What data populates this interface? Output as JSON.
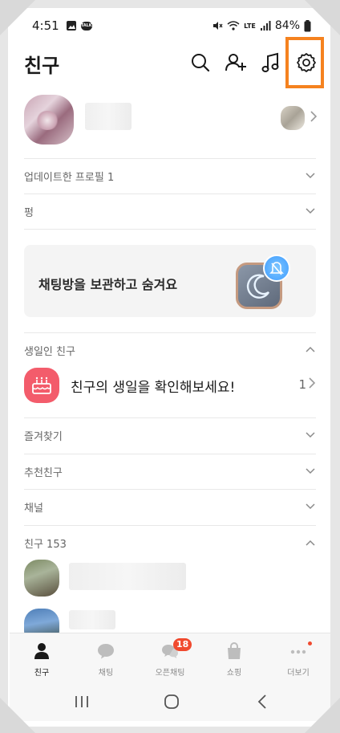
{
  "status_bar": {
    "time": "4:51",
    "talk_badge": "TALK",
    "battery": "84%",
    "network": "LTE"
  },
  "header": {
    "title": "친구"
  },
  "rows": {
    "updated_profiles": "업데이트한 프로필 1",
    "pung": "펑"
  },
  "banner": {
    "text": "채팅방을 보관하고 숨겨요"
  },
  "birthday_section": {
    "header": "생일인 친구",
    "message": "친구의 생일을 확인해보세요!",
    "count": "1"
  },
  "sections": {
    "favorites": "즐겨찾기",
    "recommended": "추천친구",
    "channels": "채널",
    "friends": "친구 153"
  },
  "tabs": [
    {
      "label": "친구",
      "icon": "person-icon"
    },
    {
      "label": "채팅",
      "icon": "chat-bubble-icon"
    },
    {
      "label": "오픈채팅",
      "icon": "open-chat-icon",
      "badge": "18"
    },
    {
      "label": "쇼핑",
      "icon": "shopping-bag-icon"
    },
    {
      "label": "더보기",
      "icon": "more-dots-icon"
    }
  ],
  "colors": {
    "highlight": "#f5821f",
    "badge": "#f04a2f",
    "birthday": "#f35c6b"
  }
}
